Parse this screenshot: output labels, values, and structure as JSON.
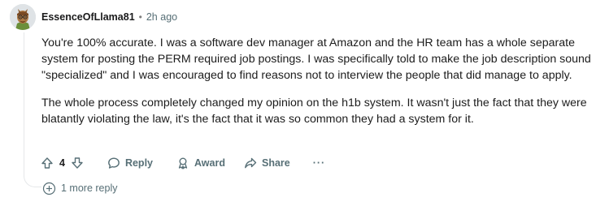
{
  "comment": {
    "username": "EssenceOfLlama81",
    "separator": "•",
    "time": "2h ago",
    "paragraphs": [
      "You're 100% accurate. I was a software dev manager at Amazon and the HR team has a whole separate system for posting the PERM required job postings. I was specifically told to make the job description sound \"specialized\" and I was encouraged to find reasons not to interview the people that did manage to apply.",
      "The whole process completely changed my opinion on the h1b system. It wasn't just the fact that they were blatantly violating the law, it's the fact that it was so common they had a system for it."
    ]
  },
  "actions": {
    "vote_count": "4",
    "reply_label": "Reply",
    "award_label": "Award",
    "share_label": "Share",
    "more_label": "···"
  },
  "more_replies": {
    "label": "1 more reply"
  },
  "icons": {
    "upvote": "upvote-arrow-icon",
    "downvote": "downvote-arrow-icon",
    "reply": "speech-bubble-icon",
    "award": "award-icon",
    "share": "share-arrow-icon",
    "more": "ellipsis-icon",
    "expand": "plus-circle-icon"
  },
  "colors": {
    "meta_text": "#576f76",
    "thread_line": "#e5e7e9"
  }
}
